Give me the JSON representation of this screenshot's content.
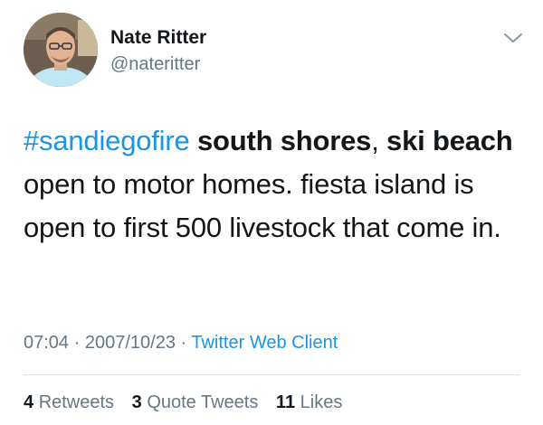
{
  "author": {
    "name": "Nate Ritter",
    "handle": "@nateritter"
  },
  "icons": {
    "menu": "chevron-down-icon",
    "avatar": "profile-photo"
  },
  "tweet": {
    "segments": [
      {
        "text": "#sandiegofire",
        "style": "hashtag"
      },
      {
        "text": " ",
        "style": "plain"
      },
      {
        "text": "south shores",
        "style": "bold"
      },
      {
        "text": ", ",
        "style": "plain"
      },
      {
        "text": "ski beach",
        "style": "bold"
      },
      {
        "text": " open to motor homes. fiesta island is open to first 500 livestock that come in.",
        "style": "plain"
      }
    ]
  },
  "meta": {
    "time": "07:04",
    "sep1": " · ",
    "date": "2007/10/23",
    "sep2": " · ",
    "source": "Twitter Web Client"
  },
  "stats": {
    "retweets_count": "4",
    "retweets_label": "Retweets",
    "quotes_count": "3",
    "quotes_label": "Quote Tweets",
    "likes_count": "11",
    "likes_label": "Likes"
  },
  "colors": {
    "link": "#1b95e0",
    "secondary_text": "#657786",
    "primary_text": "#14171a",
    "divider": "#e1e8ed"
  }
}
